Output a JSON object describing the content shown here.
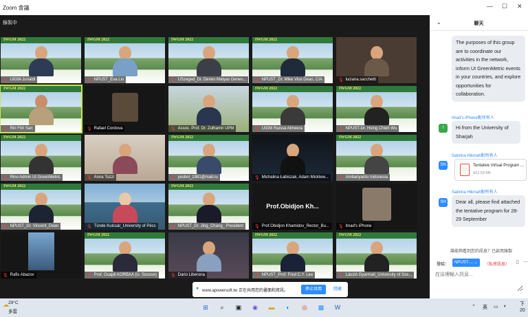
{
  "window": {
    "title": "Zoom 會議",
    "controls": [
      "—",
      "☐",
      "✕"
    ]
  },
  "recording": {
    "label": "錄製中"
  },
  "participants": [
    {
      "name": "UIGM-Junaidi",
      "banner": "IWGM 2022"
    },
    {
      "name": "NPUST_Eva Lin",
      "banner": "IWGM 2022"
    },
    {
      "name": "USzeged_Dr. Denes Matyas Denes...",
      "banner": "IWGM 2022"
    },
    {
      "name": "NPUST_Dr. Mike Vice Dean, CIA",
      "banner": "IWGM 2022"
    },
    {
      "name": "luciana.sacchetti",
      "banner": ""
    },
    {
      "name": "Riri Fitri Sari",
      "banner": "IWGM 2022"
    },
    {
      "name": "Rafael Cordova",
      "banner": ""
    },
    {
      "name": "Assoc. Prof. Dr. Zulhamri UPM",
      "banner": ""
    },
    {
      "name": "UIGM Raissa Almeera",
      "banner": "IWGM 2022"
    },
    {
      "name": "NPUST-Dr. Hsing Chieh Wu",
      "banner": "IWGM 2022"
    },
    {
      "name": "Rino Admin UI GreenMetric",
      "banner": "IWGM 2022"
    },
    {
      "name": "Anna Tozzi",
      "banner": ""
    },
    {
      "name": "yesbol_1981@mail.ru",
      "banner": "IWGM 2022"
    },
    {
      "name": "Michalina Łabiszak, Adam Micklew...",
      "banner": ""
    },
    {
      "name": "Ambariyanto Indonesia",
      "banner": "IWGM 2022"
    },
    {
      "name": "NPUST_Dr. Vincent_Dean",
      "banner": "IWGM 2022"
    },
    {
      "name": "Tünde Kulcsár_University of Pécs",
      "banner": ""
    },
    {
      "name": "NPUST_Dr. Jing_Chang_ President",
      "banner": "IWGM 2022"
    },
    {
      "name": "Prof.Obidjon Khamidov_Rector_Bu...",
      "banner": "",
      "big_label": "Prof.Obidjon  Kh..."
    },
    {
      "name": "Imad's iPhone",
      "banner": ""
    },
    {
      "name": "Rafis Abazov",
      "banner": ""
    },
    {
      "name": "Prof. Ouajdi KORBAA (U. Sousse)",
      "banner": "IWGM 2022"
    },
    {
      "name": "Dario Liberona",
      "banner": ""
    },
    {
      "name": "NPUST_Prof. Fred C.Y. Lee",
      "banner": "IWGM 2022"
    },
    {
      "name": "László Gyarmati_University of Sze...",
      "banner": "IWGM 2022"
    }
  ],
  "screen_share": {
    "text": "www.apowersoft.tw 正在共用您的畫面和資訊。",
    "stop_label": "停止共用",
    "hide_label": "隱藏"
  },
  "chat": {
    "title": "聊天",
    "msg1": "The purposes of this group are to coordinate our activities in the network, inform UI GreenMetric events in your countries, and explore opportunities for collaboration.",
    "sender2": "Imad's iPhone對所有人",
    "avatar2": "I",
    "msg2": "Hi from the University of Sharjah",
    "sender3": "Sabrina Hikmah對所有人",
    "avatar3": "SH",
    "file_name": "Tentative Virtual Program ...",
    "file_size": "412.53 KB",
    "sender4": "Sabrina Hikmah對所有人",
    "avatar4": "SH",
    "msg4": "Dear all, please find attached the tentative program for 28-29 September",
    "notice": "誰能夠看到您的訊息？已啟用錄製",
    "to_label": "發給：",
    "to_value": "NPUST-... ⌄",
    "private_note": "（私密訊息）",
    "placeholder": "在這裡輸入訊息..."
  },
  "taskbar": {
    "temperature": "29°C",
    "condition": "多雲",
    "ime": "英",
    "time": "下",
    "date": "20"
  }
}
